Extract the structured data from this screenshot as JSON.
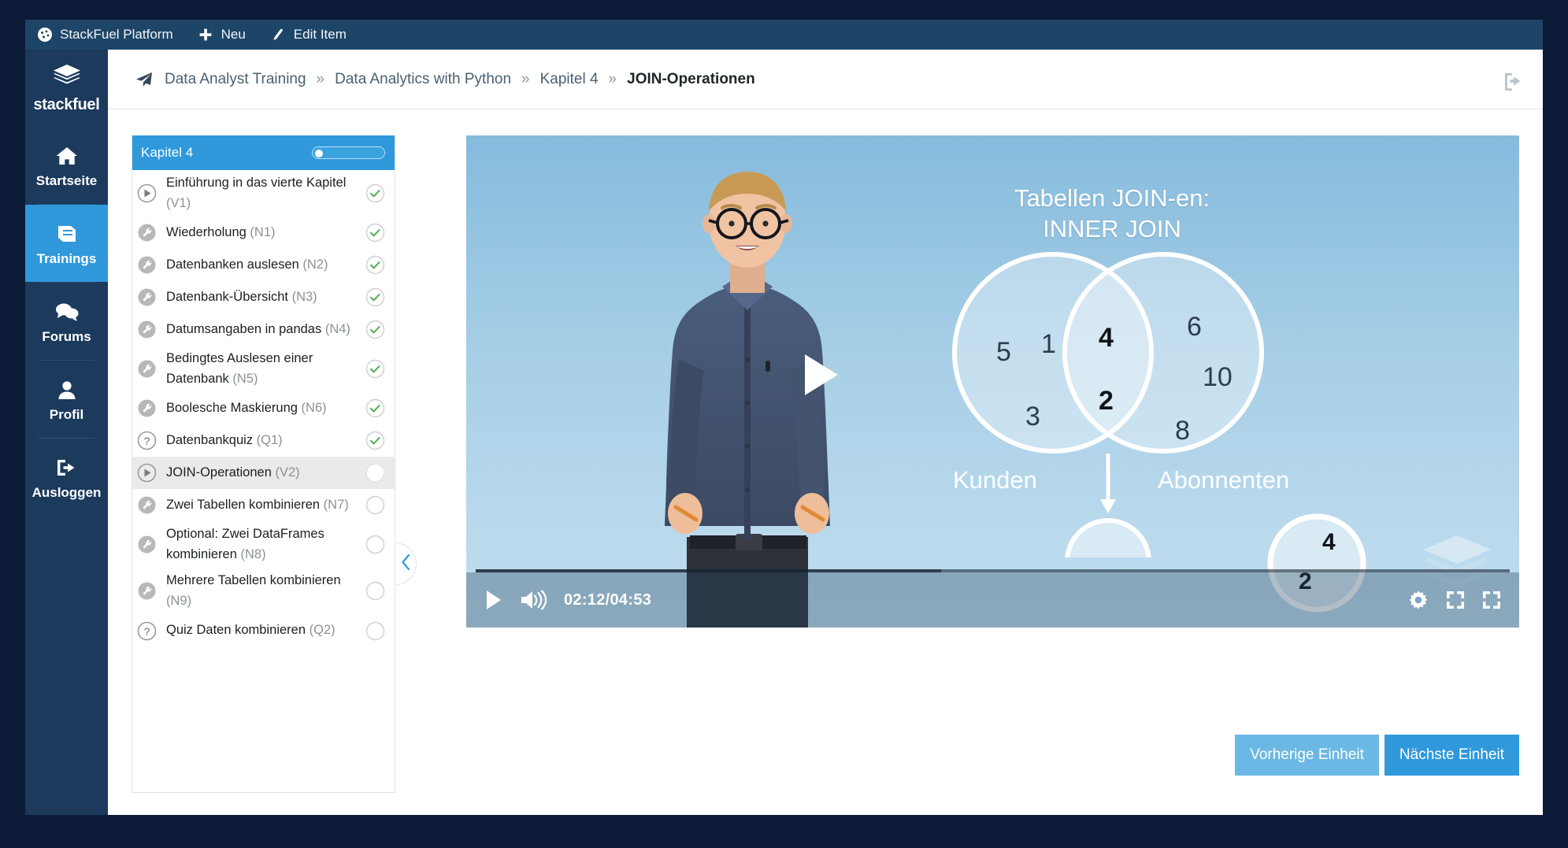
{
  "admin_bar": {
    "items": [
      {
        "label": "StackFuel Platform",
        "icon": "dashboard-icon"
      },
      {
        "label": "Neu",
        "icon": "plus-icon"
      },
      {
        "label": "Edit Item",
        "icon": "pencil-icon"
      }
    ]
  },
  "sidebar": {
    "brand": "stackfuel",
    "brand_icon": "layers-icon",
    "items": [
      {
        "label": "Startseite",
        "icon": "home-icon",
        "active": false
      },
      {
        "label": "Trainings",
        "icon": "book-icon",
        "active": true
      },
      {
        "label": "Forums",
        "icon": "chat-icon",
        "active": false
      },
      {
        "label": "Profil",
        "icon": "user-icon",
        "active": false
      },
      {
        "label": "Ausloggen",
        "icon": "logout-icon",
        "active": false
      }
    ]
  },
  "breadcrumb": {
    "home_icon": "paper-plane-icon",
    "separator": "»",
    "items": [
      "Data Analyst Training",
      "Data Analytics with Python",
      "Kapitel 4",
      "JOIN-Operationen"
    ],
    "logout_icon": "logout-icon"
  },
  "chapter_panel": {
    "title": "Kapitel 4",
    "progress_percent": 8,
    "collapse_icon": "chevron-left-icon",
    "items": [
      {
        "title": "Einführung in das vierte Kapitel",
        "code": "(V1)",
        "type": "video",
        "status": "done",
        "active": false
      },
      {
        "title": "Wiederholung",
        "code": "(N1)",
        "type": "notebook",
        "status": "done",
        "active": false
      },
      {
        "title": "Datenbanken auslesen",
        "code": "(N2)",
        "type": "notebook",
        "status": "done",
        "active": false
      },
      {
        "title": "Datenbank-Übersicht",
        "code": "(N3)",
        "type": "notebook",
        "status": "done",
        "active": false
      },
      {
        "title": "Datumsangaben in pandas",
        "code": "(N4)",
        "type": "notebook",
        "status": "done",
        "active": false
      },
      {
        "title": "Bedingtes Auslesen einer Datenbank",
        "code": "(N5)",
        "type": "notebook",
        "status": "done",
        "active": false
      },
      {
        "title": "Boolesche Maskierung",
        "code": "(N6)",
        "type": "notebook",
        "status": "done",
        "active": false
      },
      {
        "title": "Datenbankquiz",
        "code": "(Q1)",
        "type": "quiz",
        "status": "done",
        "active": false
      },
      {
        "title": "JOIN-Operationen",
        "code": "(V2)",
        "type": "video",
        "status": "current",
        "active": true
      },
      {
        "title": "Zwei Tabellen kombinieren",
        "code": "(N7)",
        "type": "notebook",
        "status": "open",
        "active": false
      },
      {
        "title": "Optional: Zwei DataFrames kombinieren",
        "code": "(N8)",
        "type": "notebook",
        "status": "open",
        "active": false
      },
      {
        "title": "Mehrere Tabellen kombinieren",
        "code": "(N9)",
        "type": "notebook",
        "status": "open",
        "active": false
      },
      {
        "title": "Quiz Daten kombinieren",
        "code": "(Q2)",
        "type": "quiz",
        "status": "open",
        "active": false
      }
    ]
  },
  "video": {
    "slide_title_line1": "Tabellen JOIN-en:",
    "slide_title_line2": "INNER JOIN",
    "play_overlay_icon": "play-icon",
    "current_time": "02:12",
    "duration": "04:53",
    "timecode": "02:12/04:53",
    "play_icon": "play-icon",
    "volume_icon": "volume-icon",
    "settings_icon": "gear-icon",
    "pip_icon": "picture-in-picture-icon",
    "fullscreen_icon": "fullscreen-icon",
    "watermark_icon": "layers-icon",
    "progress_percent": 45,
    "venn": {
      "left_label": "Kunden",
      "right_label": "Abonnenten",
      "left_only": [
        "5",
        "1",
        "3"
      ],
      "intersection": [
        "4",
        "2"
      ],
      "right_only": [
        "6",
        "10",
        "8"
      ],
      "result": [
        "4",
        "2"
      ]
    }
  },
  "footer": {
    "prev_label": "Vorherige Einheit",
    "next_label": "Nächste Einheit"
  },
  "colors": {
    "brand_dark": "#1b3a5c",
    "admin_bar": "#1d4567",
    "accent_blue": "#2f99dc",
    "accent_light": "#6cb8e4",
    "page_bg": "#0b1b38",
    "done_green": "#4caf50"
  }
}
